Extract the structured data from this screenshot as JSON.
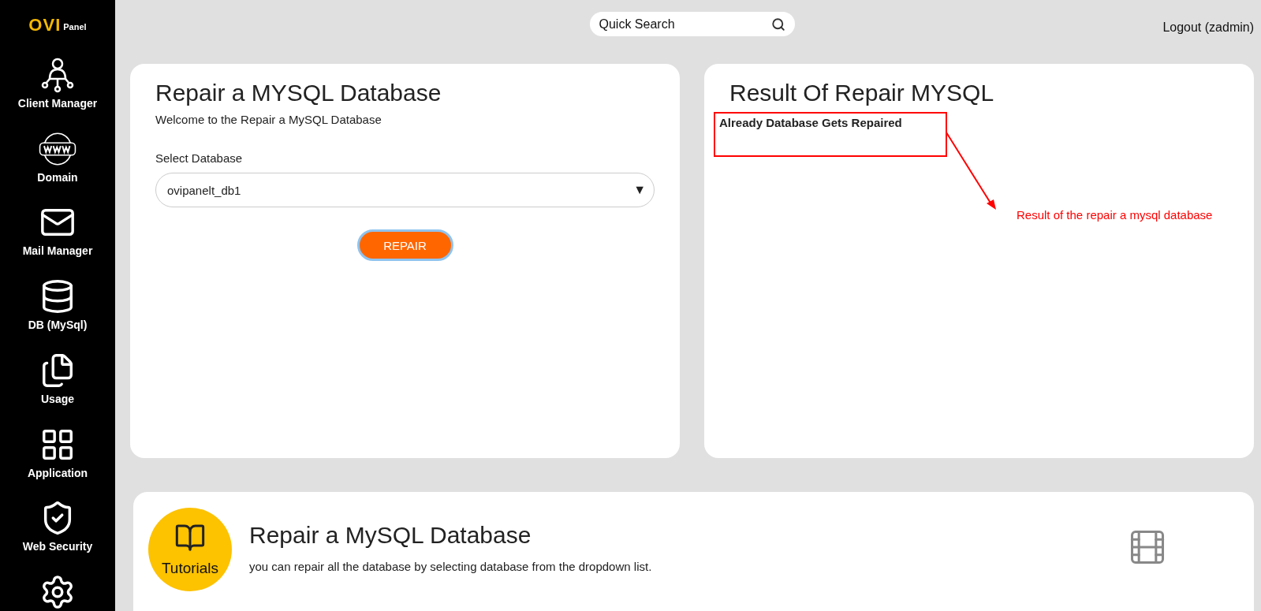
{
  "logo": {
    "mark": "OVI",
    "text": "Panel"
  },
  "sidebar": {
    "items": [
      {
        "label": "Client Manager"
      },
      {
        "label": "Domain"
      },
      {
        "label": "Mail Manager"
      },
      {
        "label": "DB (MySql)"
      },
      {
        "label": "Usage"
      },
      {
        "label": "Application"
      },
      {
        "label": "Web Security"
      }
    ]
  },
  "topbar": {
    "search": {
      "placeholder": "Quick Search"
    },
    "logout": "Logout (zadmin)"
  },
  "repair_card": {
    "title": "Repair a MYSQL Database",
    "subtitle": "Welcome to the Repair a MySQL Database",
    "select_label": "Select Database",
    "select_value": "ovipanelt_db1",
    "caret": "▼",
    "button": "REPAIR"
  },
  "result_card": {
    "title": "Result Of Repair MYSQL",
    "message": "Already Database Gets Repaired",
    "annotation": "Result of the repair a mysql database"
  },
  "tutorial": {
    "badge": "Tutorials",
    "title": "Repair a MySQL Database",
    "description": "you can repair all the database by selecting database from the dropdown list."
  }
}
